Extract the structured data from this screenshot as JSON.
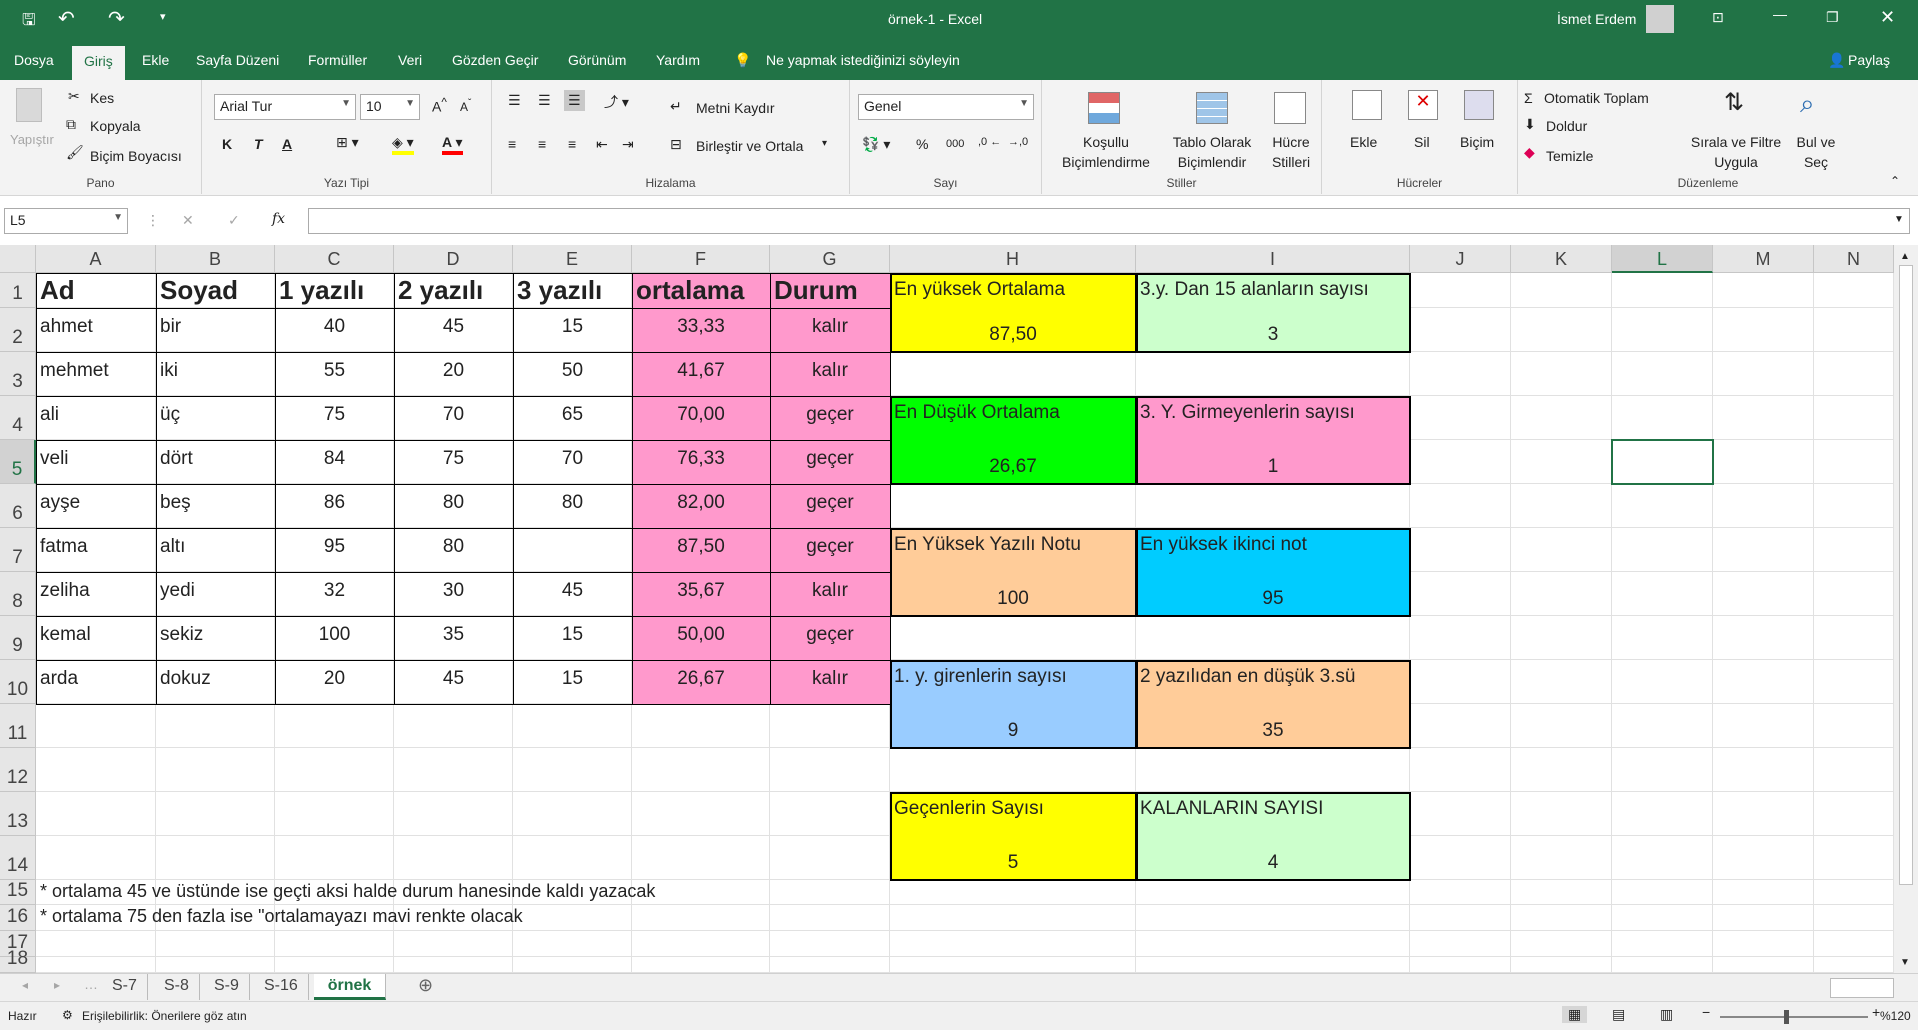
{
  "window": {
    "title": "örnek-1  -  Excel",
    "user": "İsmet Erdem"
  },
  "tabs": [
    "Dosya",
    "Giriş",
    "Ekle",
    "Sayfa Düzeni",
    "Formüller",
    "Veri",
    "Gözden Geçir",
    "Görünüm",
    "Yardım"
  ],
  "tell_me": "Ne yapmak istediğinizi söyleyin",
  "share": "Paylaş",
  "ribbon": {
    "clipboard": {
      "paste": "Yapıştır",
      "cut": "Kes",
      "copy": "Kopyala",
      "painter": "Biçim Boyacısı",
      "label": "Pano"
    },
    "font": {
      "name": "Arial Tur",
      "size": "10",
      "bold": "K",
      "italic": "T",
      "underline": "A",
      "label": "Yazı Tipi"
    },
    "alignment": {
      "wrap": "Metni Kaydır",
      "merge": "Birleştir ve Ortala",
      "label": "Hizalama"
    },
    "number": {
      "format": "Genel",
      "percent": "%",
      "thousands": "000",
      "label": "Sayı"
    },
    "styles": {
      "conditional": [
        "Koşullu",
        "Biçimlendirme"
      ],
      "table": [
        "Tablo Olarak",
        "Biçimlendir"
      ],
      "cell": [
        "Hücre",
        "Stilleri"
      ],
      "label": "Stiller"
    },
    "cells": {
      "insert": "Ekle",
      "delete": "Sil",
      "format": "Biçim",
      "label": "Hücreler"
    },
    "editing": {
      "autosum": "Otomatik Toplam",
      "fill": "Doldur",
      "clear": "Temizle",
      "sort": [
        "Sırala ve Filtre",
        "Uygula"
      ],
      "find": [
        "Bul ve",
        "Seç"
      ],
      "label": "Düzenleme"
    }
  },
  "name_box": "L5",
  "fx": "fx",
  "columns": [
    "A",
    "B",
    "C",
    "D",
    "E",
    "F",
    "G",
    "H",
    "I",
    "J",
    "K",
    "L",
    "M",
    "N"
  ],
  "rows": [
    "1",
    "2",
    "3",
    "4",
    "5",
    "6",
    "7",
    "8",
    "9",
    "10",
    "11",
    "12",
    "13",
    "14",
    "15",
    "16",
    "17",
    "18"
  ],
  "table": {
    "headers": [
      "Ad",
      "Soyad",
      "1 yazılı",
      "2 yazılı",
      "3 yazılı",
      "ortalama",
      "Durum"
    ],
    "rows": [
      [
        "ahmet",
        "bir",
        "40",
        "45",
        "15",
        "33,33",
        "kalır"
      ],
      [
        "mehmet",
        "iki",
        "55",
        "20",
        "50",
        "41,67",
        "kalır"
      ],
      [
        "ali",
        "üç",
        "75",
        "70",
        "65",
        "70,00",
        "geçer"
      ],
      [
        "veli",
        "dört",
        "84",
        "75",
        "70",
        "76,33",
        "geçer"
      ],
      [
        "ayşe",
        "beş",
        "86",
        "80",
        "80",
        "82,00",
        "geçer"
      ],
      [
        "fatma",
        "altı",
        "95",
        "80",
        "",
        "87,50",
        "geçer"
      ],
      [
        "zeliha",
        "yedi",
        "32",
        "30",
        "45",
        "35,67",
        "kalır"
      ],
      [
        "kemal",
        "sekiz",
        "100",
        "35",
        "15",
        "50,00",
        "geçer"
      ],
      [
        "arda",
        "dokuz",
        "20",
        "45",
        "15",
        "26,67",
        "kalır"
      ]
    ]
  },
  "notes": [
    "* ortalama 45 ve üstünde ise geçti aksi halde durum hanesinde kaldı yazacak",
    "* ortalama 75 den fazla ise \"ortalamayazı mavi renkte olacak"
  ],
  "summary": [
    {
      "label": "En yüksek Ortalama",
      "value": "87,50",
      "color": "#ffff00"
    },
    {
      "label": "3.y. Dan 15 alanların sayısı",
      "value": "3",
      "color": "#ccffcc"
    },
    {
      "label": "En Düşük Ortalama",
      "value": "26,67",
      "color": "#00ff00"
    },
    {
      "label": "3. Y. Girmeyenlerin sayısı",
      "value": "1",
      "color": "#ff99cc"
    },
    {
      "label": "En Yüksek Yazılı Notu",
      "value": "100",
      "color": "#ffcc99"
    },
    {
      "label": "En yüksek ikinci not",
      "value": "95",
      "color": "#00ccff"
    },
    {
      "label": "1. y. girenlerin sayısı",
      "value": "9",
      "color": "#99ccff"
    },
    {
      "label": "2 yazılıdan en düşük 3.sü",
      "value": "35",
      "color": "#ffcc99"
    },
    {
      "label": "Geçenlerin Sayısı",
      "value": "5",
      "color": "#ffff00"
    },
    {
      "label": "KALANLARIN SAYISI",
      "value": "4",
      "color": "#ccffcc"
    }
  ],
  "colors": {
    "pink": "#ff99cc",
    "excel_green": "#217346"
  },
  "sheets": [
    "S-7",
    "S-8",
    "S-9",
    "S-16",
    "örnek"
  ],
  "active_sheet": "örnek",
  "status": {
    "ready": "Hazır",
    "accessibility": "Erişilebilirlik: Önerilere göz atın",
    "zoom": "%120"
  }
}
